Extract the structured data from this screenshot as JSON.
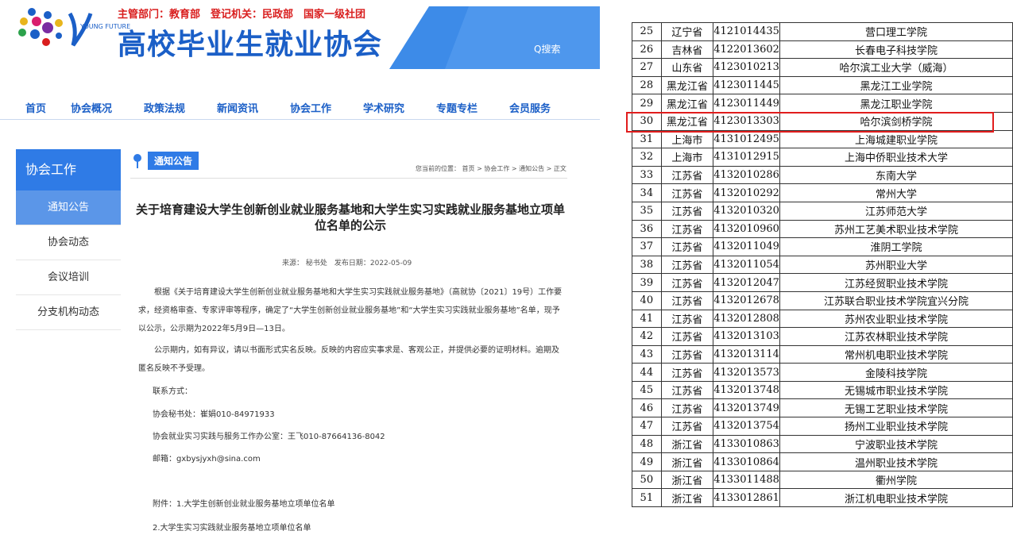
{
  "header": {
    "dept_line": "主管部门：教育部　登记机关：民政部　国家一级社团",
    "site_title": "高校毕业生就业协会",
    "logo_text": "YOUNG FUTURE",
    "search_label": "Q搜索"
  },
  "nav": [
    "首页",
    "协会概况",
    "政策法规",
    "新闻资讯",
    "协会工作",
    "学术研究",
    "专题专栏",
    "会员服务"
  ],
  "sidebar": {
    "title": "协会工作",
    "items": [
      "通知公告",
      "协会动态",
      "会议培训",
      "分支机构动态"
    ]
  },
  "article": {
    "section_label": "通知公告",
    "breadcrumb": "您当前的位置：  首页 > 协会工作 > 通知公告 > 正文",
    "title": "关于培育建设大学生创新创业就业服务基地和大学生实习实践就业服务基地立项单位名单的公示",
    "meta": "来源：  秘书处　发布日期：2022-05-09",
    "para1": "根据《关于培育建设大学生创新创业就业服务基地和大学生实习实践就业服务基地》（高就协〔2021〕19号）工作要求，经资格审查、专家评审等程序，确定了“大学生创新创业就业服务基地”和“大学生实习实践就业服务基地”名单，现予以公示，公示期为2022年5月9日—13日。",
    "para2": "公示期内，如有异议，请以书面形式实名反映。反映的内容应实事求是、客观公正，并提供必要的证明材料。逾期及匿名反映不予受理。",
    "contact_label": "联系方式：",
    "contact1": "协会秘书处：崔娟010-84971933",
    "contact2": "协会就业实习实践与服务工作办公室：王飞010-87664136-8042",
    "email": "邮箱：gxbysjyxh@sina.com",
    "attach1": "附件：1.大学生创新创业就业服务基地立项单位名单",
    "attach2": "2.大学生实习实践就业服务基地立项单位名单"
  },
  "table": {
    "highlight_row": "30",
    "rows": [
      [
        "25",
        "辽宁省",
        "4121014435",
        "营口理工学院"
      ],
      [
        "26",
        "吉林省",
        "4122013602",
        "长春电子科技学院"
      ],
      [
        "27",
        "山东省",
        "4123010213",
        "哈尔滨工业大学（威海）"
      ],
      [
        "28",
        "黑龙江省",
        "4123011445",
        "黑龙江工业学院"
      ],
      [
        "29",
        "黑龙江省",
        "4123011449",
        "黑龙江职业学院"
      ],
      [
        "30",
        "黑龙江省",
        "4123013303",
        "哈尔滨剑桥学院"
      ],
      [
        "31",
        "上海市",
        "4131012495",
        "上海城建职业学院"
      ],
      [
        "32",
        "上海市",
        "4131012915",
        "上海中侨职业技术大学"
      ],
      [
        "33",
        "江苏省",
        "4132010286",
        "东南大学"
      ],
      [
        "34",
        "江苏省",
        "4132010292",
        "常州大学"
      ],
      [
        "35",
        "江苏省",
        "4132010320",
        "江苏师范大学"
      ],
      [
        "36",
        "江苏省",
        "4132010960",
        "苏州工艺美术职业技术学院"
      ],
      [
        "37",
        "江苏省",
        "4132011049",
        "淮阴工学院"
      ],
      [
        "38",
        "江苏省",
        "4132011054",
        "苏州职业大学"
      ],
      [
        "39",
        "江苏省",
        "4132012047",
        "江苏经贸职业技术学院"
      ],
      [
        "40",
        "江苏省",
        "4132012678",
        "江苏联合职业技术学院宜兴分院"
      ],
      [
        "41",
        "江苏省",
        "4132012808",
        "苏州农业职业技术学院"
      ],
      [
        "42",
        "江苏省",
        "4132013103",
        "江苏农林职业技术学院"
      ],
      [
        "43",
        "江苏省",
        "4132013114",
        "常州机电职业技术学院"
      ],
      [
        "44",
        "江苏省",
        "4132013573",
        "金陵科技学院"
      ],
      [
        "45",
        "江苏省",
        "4132013748",
        "无锡城市职业技术学院"
      ],
      [
        "46",
        "江苏省",
        "4132013749",
        "无锡工艺职业技术学院"
      ],
      [
        "47",
        "江苏省",
        "4132013754",
        "扬州工业职业技术学院"
      ],
      [
        "48",
        "浙江省",
        "4133010863",
        "宁波职业技术学院"
      ],
      [
        "49",
        "浙江省",
        "4133010864",
        "温州职业技术学院"
      ],
      [
        "50",
        "浙江省",
        "4133011488",
        "衢州学院"
      ],
      [
        "51",
        "浙江省",
        "4133012861",
        "浙江机电职业技术学院"
      ]
    ]
  }
}
